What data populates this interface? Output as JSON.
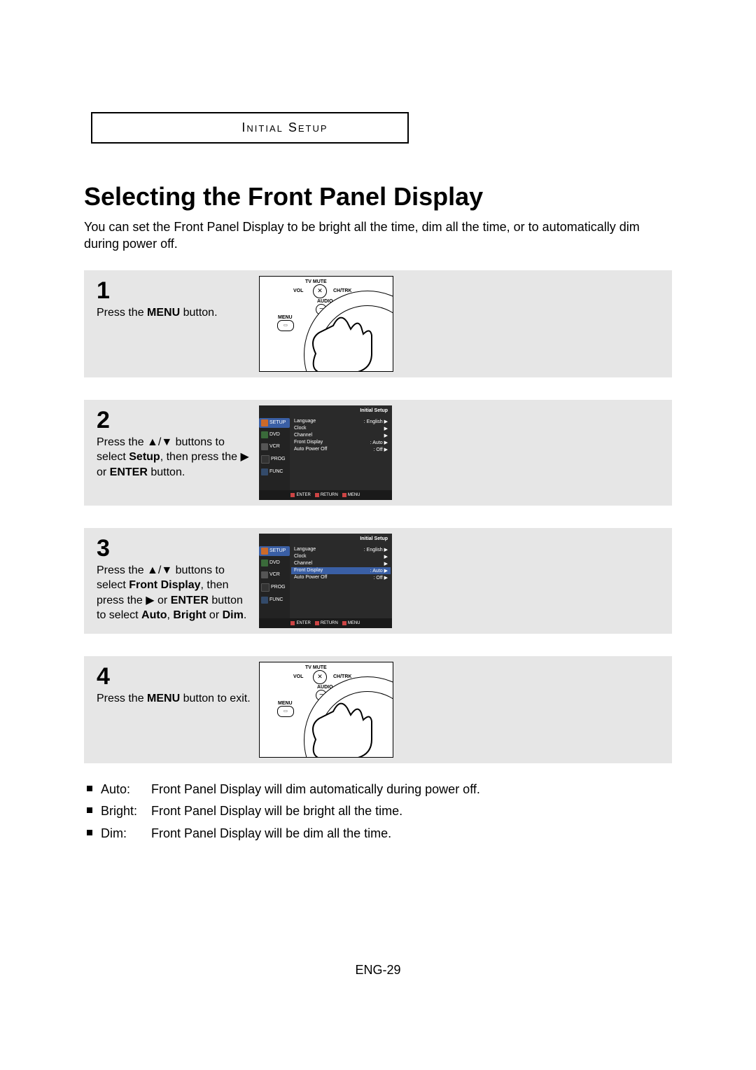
{
  "header": {
    "section_label": "Initial Setup"
  },
  "title": "Selecting the Front Panel Display",
  "intro": "You can set the Front Panel Display to be bright all the time, dim all the time, or to automatically dim during power off.",
  "steps": [
    {
      "num": "1",
      "text_before": "Press the ",
      "bold1": "MENU",
      "text_after": " button.",
      "visual": "remote"
    },
    {
      "num": "2",
      "line1_before": "Press the ",
      "line1_after": " buttons to",
      "line2_before": "select ",
      "line2_bold": "Setup",
      "line2_after": ", then press the ",
      "line3_before": "or ",
      "line3_bold": "ENTER",
      "line3_after": " button.",
      "visual": "osd"
    },
    {
      "num": "3",
      "l1_before": "Press the ",
      "l1_after": " buttons to",
      "l2_before": "select ",
      "l2_bold": "Front Display",
      "l2_after": ", then",
      "l3_before": "press the ",
      "l3_mid": " or ",
      "l3_bold": "ENTER",
      "l3_after": " button",
      "l4_before": "to select ",
      "l4_b1": "Auto",
      "l4_m1": ", ",
      "l4_b2": "Bright",
      "l4_m2": " or ",
      "l4_b3": "Dim",
      "l4_after": ".",
      "visual": "osd_highlight"
    },
    {
      "num": "4",
      "text_before": "Press the ",
      "bold1": "MENU",
      "text_after": " button to exit.",
      "visual": "remote"
    }
  ],
  "remote_labels": {
    "tv_mute": "TV MUTE",
    "vol": "VOL",
    "chtrk": "CH/TRK",
    "audio": "AUDIO",
    "menu": "MENU",
    "mute_icon": "✕"
  },
  "osd": {
    "title": "Initial Setup",
    "side": [
      {
        "label": "SETUP",
        "icon": "setup",
        "selected": true
      },
      {
        "label": "DVD",
        "icon": "dvd"
      },
      {
        "label": "VCR",
        "icon": "vcr"
      },
      {
        "label": "PROG",
        "icon": "prog"
      },
      {
        "label": "FUNC",
        "icon": "func"
      }
    ],
    "rows": [
      {
        "label": "Language",
        "value": ": English"
      },
      {
        "label": "Clock",
        "value": ""
      },
      {
        "label": "Channel",
        "value": ""
      },
      {
        "label": "Front Display",
        "value": ": Auto"
      },
      {
        "label": "Auto Power Off",
        "value": ": Off"
      }
    ],
    "footer": {
      "enter": "ENTER",
      "return": "RETURN",
      "menu": "MENU"
    }
  },
  "definitions": [
    {
      "label": "Auto:",
      "desc": "Front Panel Display will dim automatically during power off."
    },
    {
      "label": "Bright:",
      "desc": "Front Panel Display will be bright all the time."
    },
    {
      "label": "Dim:",
      "desc": "Front Panel Display will be dim all the time."
    }
  ],
  "page_number": "ENG-29"
}
